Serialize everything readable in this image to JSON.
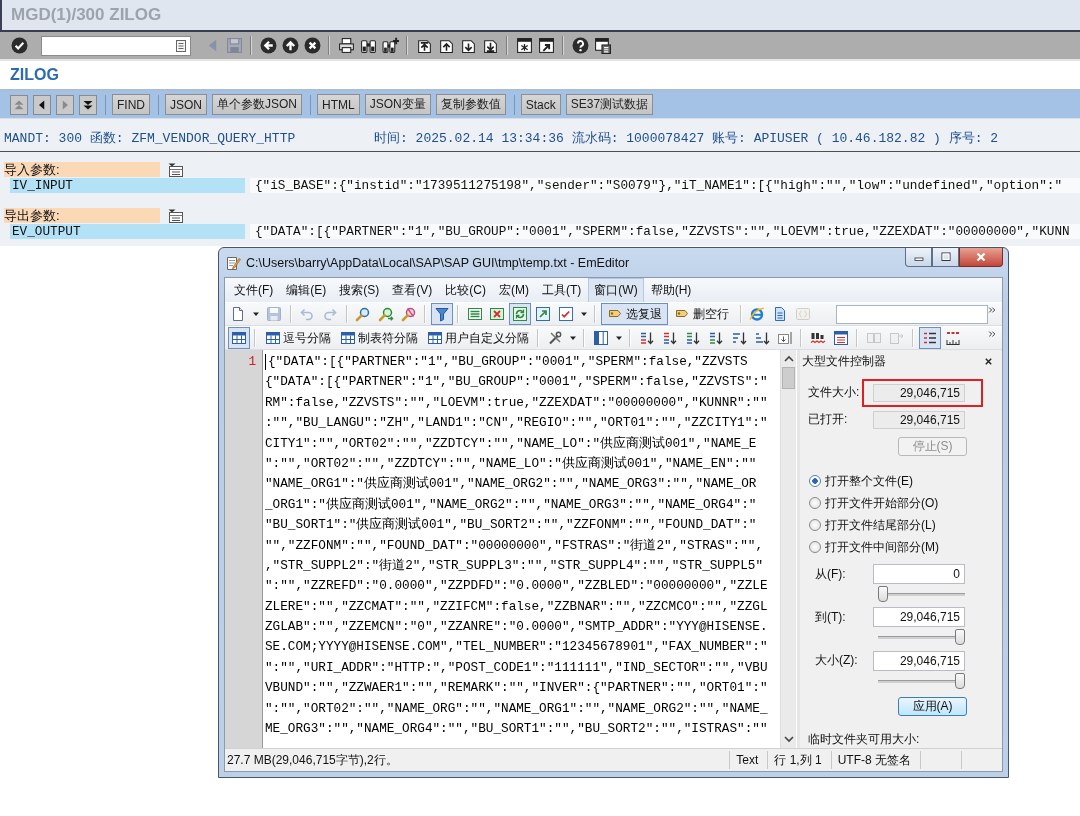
{
  "sap_window": {
    "title": "MGD(1)/300 ZILOG"
  },
  "system_toolbar": {
    "enter_button": {
      "disabled": false
    },
    "groups": [
      [
        {
          "kind": "triangle",
          "disabled": true
        },
        {
          "kind": "floppy",
          "disabled": true
        }
      ],
      [
        {
          "kind": "back",
          "disabled": false
        },
        {
          "kind": "up",
          "disabled": false
        },
        {
          "kind": "cancel",
          "disabled": false
        }
      ],
      [
        {
          "kind": "print",
          "disabled": false
        },
        {
          "kind": "find",
          "disabled": false
        },
        {
          "kind": "findnext",
          "disabled": false
        }
      ],
      [
        {
          "kind": "pagefirst",
          "disabled": false
        },
        {
          "kind": "pageprev",
          "disabled": false
        },
        {
          "kind": "pagenext",
          "disabled": false
        },
        {
          "kind": "pagelast",
          "disabled": false
        }
      ],
      [
        {
          "kind": "newsession",
          "disabled": false
        },
        {
          "kind": "shortcut",
          "disabled": false
        }
      ],
      [
        {
          "kind": "help",
          "disabled": false
        },
        {
          "kind": "layout",
          "disabled": false
        }
      ]
    ]
  },
  "app_title": "ZILOG",
  "app_toolbar": {
    "nav_buttons": [
      {
        "kind": "top",
        "disabled": true
      },
      {
        "kind": "left",
        "disabled": false
      },
      {
        "kind": "right",
        "disabled": true
      },
      {
        "kind": "bottom",
        "disabled": false
      }
    ],
    "button_groups": [
      [
        {
          "label": "FIND"
        }
      ],
      [
        {
          "label": "JSON"
        },
        {
          "label": "单个参数JSON"
        }
      ],
      [
        {
          "label": "HTML"
        },
        {
          "label": "JSON变量"
        },
        {
          "label": "复制参数值"
        }
      ],
      [
        {
          "label": "Stack"
        },
        {
          "label": "SE37测试数据"
        }
      ]
    ]
  },
  "log_header": {
    "call_info": "MANDT: 300 函数: ZFM_VENDOR_QUERY_HTTP",
    "run_info": "时间: 2025.02.14 13:34:36 流水码: 1000078427 账号: APIUSER ( 10.46.182.82 ) 序号: 2"
  },
  "parameter_sections": [
    {
      "heading": "导入参数:",
      "rows": [
        {
          "name": "IV_INPUT",
          "value": "{\"iS_BASE\":{\"instid\":\"1739511275198\",\"sender\":\"S0079\"},\"iT_NAME1\":[{\"high\":\"\",\"low\":\"undefined\",\"option\":\""
        }
      ]
    },
    {
      "heading": "导出参数:",
      "rows": [
        {
          "name": "EV_OUTPUT",
          "value": "{\"DATA\":[{\"PARTNER\":\"1\",\"BU_GROUP\":\"0001\",\"SPERM\":false,\"ZZVSTS\":\"\",\"LOEVM\":true,\"ZZEXDAT\":\"00000000\",\"KUNN"
        }
      ]
    }
  ],
  "editor_window": {
    "title": "C:\\Users\\barry\\AppData\\Local\\SAP\\SAP GUI\\tmp\\temp.txt - EmEditor",
    "menu": [
      {
        "label": "文件(F)",
        "selected": false
      },
      {
        "label": "编辑(E)",
        "selected": false
      },
      {
        "label": "搜索(S)",
        "selected": false
      },
      {
        "label": "查看(V)",
        "selected": false
      },
      {
        "label": "比较(C)",
        "selected": false
      },
      {
        "label": "宏(M)",
        "selected": false
      },
      {
        "label": "工具(T)",
        "selected": false
      },
      {
        "label": "窗口(W)",
        "selected": true
      },
      {
        "label": "帮助(H)",
        "selected": false
      }
    ],
    "toolbar_rows": [
      {
        "groups": [
          [
            {
              "kind": "newfile",
              "on": false,
              "disabled": false
            },
            {
              "kind": "caret",
              "on": false,
              "disabled": false
            },
            {
              "kind": "save",
              "on": false,
              "disabled": true
            }
          ],
          [
            {
              "kind": "undo",
              "on": false,
              "disabled": true
            },
            {
              "kind": "redo",
              "on": false,
              "disabled": true
            }
          ],
          [
            {
              "kind": "search",
              "on": false,
              "disabled": false
            },
            {
              "kind": "searchnext",
              "on": false,
              "disabled": false
            },
            {
              "kind": "unhighlight",
              "on": false,
              "disabled": false
            }
          ],
          [
            {
              "kind": "filter",
              "on": true,
              "disabled": false
            }
          ],
          [
            {
              "kind": "list",
              "on": false,
              "disabled": false
            },
            {
              "kind": "listx",
              "on": false,
              "disabled": false
            },
            {
              "kind": "refresh",
              "on": true,
              "disabled": false
            },
            {
              "kind": "export",
              "on": false,
              "disabled": false
            },
            {
              "kind": "checklist",
              "on": false,
              "disabled": false
            },
            {
              "kind": "caret",
              "on": false,
              "disabled": false
            }
          ],
          [
            {
              "kind": "command",
              "label": "选复退",
              "on": true,
              "disabled": false
            },
            {
              "kind": "command",
              "label": "删空行",
              "on": false,
              "disabled": false
            }
          ],
          [
            {
              "kind": "browser",
              "on": false,
              "disabled": false
            },
            {
              "kind": "document",
              "on": false,
              "disabled": false
            },
            {
              "kind": "braces",
              "on": false,
              "disabled": true
            }
          ]
        ],
        "field": {
          "disabled": false
        }
      },
      {
        "groups": [
          [
            {
              "kind": "table",
              "on": true,
              "disabled": false
            }
          ],
          [
            {
              "kind": "delimiter",
              "label": "逗号分隔",
              "on": false,
              "disabled": false
            },
            {
              "kind": "delimiter",
              "label": "制表符分隔",
              "on": false,
              "disabled": false
            },
            {
              "kind": "delimiter",
              "label": "用户自定义分隔",
              "on": false,
              "disabled": false
            }
          ],
          [
            {
              "kind": "tools",
              "on": false,
              "disabled": false
            },
            {
              "kind": "caret",
              "on": false,
              "disabled": false
            }
          ],
          [
            {
              "kind": "columns",
              "on": false,
              "disabled": false
            },
            {
              "kind": "caret",
              "on": false,
              "disabled": false
            }
          ],
          [
            {
              "kind": "sortaz",
              "on": false,
              "disabled": false
            },
            {
              "kind": "sortza",
              "on": false,
              "disabled": false
            },
            {
              "kind": "sort09",
              "on": false,
              "disabled": false
            },
            {
              "kind": "sort90",
              "on": false,
              "disabled": false
            },
            {
              "kind": "sortlines",
              "on": false,
              "disabled": false
            },
            {
              "kind": "sortlinesdesc",
              "on": false,
              "disabled": false
            },
            {
              "kind": "sortbox",
              "on": false,
              "disabled": false
            }
          ],
          [
            {
              "kind": "spellcheck",
              "on": false,
              "disabled": false
            },
            {
              "kind": "grid",
              "on": false,
              "disabled": false
            }
          ],
          [
            {
              "kind": "split",
              "on": false,
              "disabled": true
            },
            {
              "kind": "pagemove",
              "on": false,
              "disabled": true
            }
          ],
          [
            {
              "kind": "linenumbers",
              "on": true,
              "disabled": false
            },
            {
              "kind": "ruler",
              "on": false,
              "disabled": false
            }
          ]
        ]
      }
    ],
    "line_number": "1",
    "lines": [
      "{\"DATA\":[{\"PARTNER\":\"1\",\"BU_GROUP\":\"0001\",\"SPERM\":false,\"ZZVSTS",
      "{\"DATA\":[{\"PARTNER\":\"1\",\"BU_GROUP\":\"0001\",\"SPERM\":false,\"ZZVSTS\":\"",
      "RM\":false,\"ZZVSTS\":\"\",\"LOEVM\":true,\"ZZEXDAT\":\"00000000\",\"KUNNR\":\"\"",
      ":\"\",\"BU_LANGU\":\"ZH\",\"LAND1\":\"CN\",\"REGIO\":\"\",\"ORT01\":\"\",\"ZZCITY1\":\"",
      "CITY1\":\"\",\"ORT02\":\"\",\"ZZDTCY\":\"\",\"NAME_LO\":\"供应商测试001\",\"NAME_E",
      "\":\"\",\"ORT02\":\"\",\"ZZDTCY\":\"\",\"NAME_LO\":\"供应商测试001\",\"NAME_EN\":\"\"",
      "\"NAME_ORG1\":\"供应商测试001\",\"NAME_ORG2\":\"\",\"NAME_ORG3\":\"\",\"NAME_OR",
      "_ORG1\":\"供应商测试001\",\"NAME_ORG2\":\"\",\"NAME_ORG3\":\"\",\"NAME_ORG4\":\"",
      "\"BU_SORT1\":\"供应商测试001\",\"BU_SORT2\":\"\",\"ZZFONM\":\"\",\"FOUND_DAT\":\"",
      "\"\",\"ZZFONM\":\"\",\"FOUND_DAT\":\"00000000\",\"FSTRAS\":\"街道2\",\"STRAS\":\"\",",
      ",\"STR_SUPPL2\":\"街道2\",\"STR_SUPPL3\":\"\",\"STR_SUPPL4\":\"\",\"STR_SUPPL5\"",
      "\":\"\",\"ZZREFD\":\"0.0000\",\"ZZPDFD\":\"0.0000\",\"ZZBLED\":\"00000000\",\"ZZLE",
      "ZLERE\":\"\",\"ZZCMAT\":\"\",\"ZZIFCM\":false,\"ZZBNAR\":\"\",\"ZZCMCO\":\"\",\"ZZGL",
      "ZGLAB\":\"\",\"ZZEMCN\":\"0\",\"ZZANRE\":\"0.0000\",\"SMTP_ADDR\":\"YYY@HISENSE.",
      "SE.COM;YYYY@HISENSE.COM\",\"TEL_NUMBER\":\"12345678901\",\"FAX_NUMBER\":\"",
      "\":\"\",\"URI_ADDR\":\"HTTP:\",\"POST_CODE1\":\"111111\",\"IND_SECTOR\":\"\",\"VBU",
      "VBUND\":\"\",\"ZZWAER1\":\"\",\"REMARK\":\"\",\"INVER\":{\"PARTNER\":\"\",\"ORT01\":\"",
      "\":\"\",\"ORT02\":\"\",\"NAME_ORG\":\"\",\"NAME_ORG1\":\"\",\"NAME_ORG2\":\"\",\"NAME_",
      "ME_ORG3\":\"\",\"NAME_ORG4\":\"\",\"BU_SORT1\":\"\",\"BU_SORT2\":\"\",\"ISTRAS\":\"\""
    ],
    "large_file_panel": {
      "title": "大型文件控制器",
      "file_size": {
        "label": "文件大小:",
        "value": "29,046,715",
        "highlighted": true
      },
      "opened": {
        "label": "已打开:",
        "value": "29,046,715"
      },
      "stop_button": {
        "label": "停止(S)",
        "disabled": true
      },
      "open_modes": [
        {
          "label": "打开整个文件(E)",
          "selected": true
        },
        {
          "label": "打开文件开始部分(O)",
          "selected": false
        },
        {
          "label": "打开文件结尾部分(L)",
          "selected": false
        },
        {
          "label": "打开文件中间部分(M)",
          "selected": false
        }
      ],
      "range_fields": [
        {
          "label": "从(F):",
          "value": "0",
          "level": 0
        },
        {
          "label": "到(T):",
          "value": "29,046,715",
          "level": 1
        },
        {
          "label": "大小(Z):",
          "value": "29,046,715",
          "level": 1
        }
      ],
      "apply_button": {
        "label": "应用(A)"
      },
      "temp_space_label": "临时文件夹可用大小:"
    },
    "status_bar": {
      "summary": "27.7 MB(29,046,715字节),2行。",
      "segments": [
        "Text",
        "行 1,列 1",
        "UTF-8 无签名"
      ]
    }
  }
}
